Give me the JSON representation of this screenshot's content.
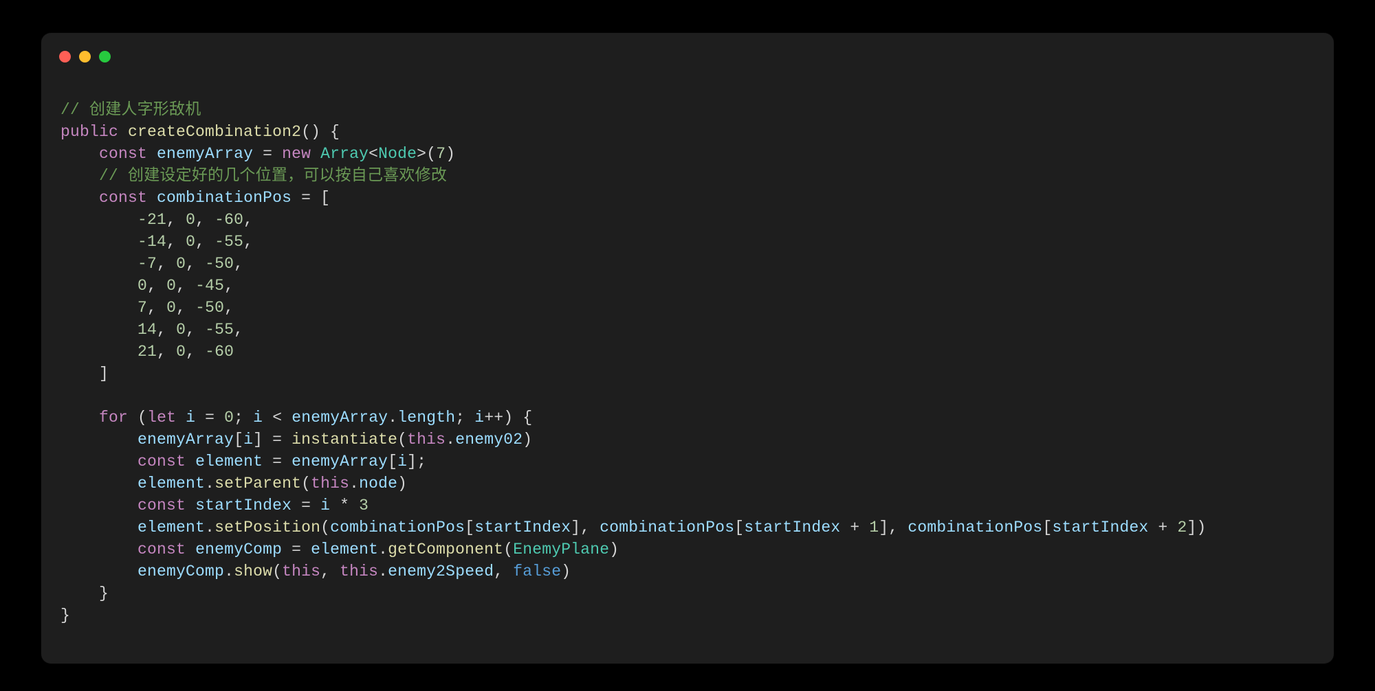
{
  "colors": {
    "window_bg": "#1e1e1e",
    "page_bg": "#000000",
    "traffic_red": "#ff5f56",
    "traffic_yellow": "#ffbd2e",
    "traffic_green": "#27c93f",
    "comment": "#6a9955",
    "keyword": "#c586c0",
    "type": "#4ec9b0",
    "function": "#dcdcaa",
    "variable": "#9cdcfe",
    "number": "#b5cea8",
    "boolean": "#569cd6",
    "default": "#d4d4d4"
  },
  "code": {
    "comment1": "// 创建人字形敌机",
    "kw_public": "public",
    "fn_createCombination2": "createCombination2",
    "paren_open": "(",
    "paren_close": ")",
    "brace_open": "{",
    "brace_close": "}",
    "kw_const": "const",
    "kw_new": "new",
    "kw_for": "for",
    "kw_let": "let",
    "kw_this": "this",
    "var_enemyArray": "enemyArray",
    "eq": " = ",
    "type_Array": "Array",
    "lt": "<",
    "gt": ">",
    "type_Node": "Node",
    "num_7": "7",
    "comment2": "// 创建设定好的几个位置，可以按自己喜欢修改",
    "var_combinationPos": "combinationPos",
    "bracket_open": "[",
    "bracket_close": "]",
    "row1": {
      "a": "-21",
      "b": "0",
      "c": "-60"
    },
    "row2": {
      "a": "-14",
      "b": "0",
      "c": "-55"
    },
    "row3": {
      "a": "-7",
      "b": "0",
      "c": "-50"
    },
    "row4": {
      "a": "0",
      "b": "0",
      "c": "-45"
    },
    "row5": {
      "a": "7",
      "b": "0",
      "c": "-50"
    },
    "row6": {
      "a": "14",
      "b": "0",
      "c": "-55"
    },
    "row7": {
      "a": "21",
      "b": "0",
      "c": "-60"
    },
    "comma": ",",
    "var_i": "i",
    "num_0": "0",
    "semicolon": ";",
    "op_lt": " < ",
    "dot": ".",
    "prop_length": "length",
    "op_inc": "++",
    "fn_instantiate": "instantiate",
    "prop_enemy02": "enemy02",
    "var_element": "element",
    "fn_setParent": "setParent",
    "prop_node": "node",
    "var_startIndex": "startIndex",
    "op_times": " * ",
    "num_3": "3",
    "fn_setPosition": "setPosition",
    "op_plus": " + ",
    "num_1": "1",
    "num_2": "2",
    "var_enemyComp": "enemyComp",
    "fn_getComponent": "getComponent",
    "type_EnemyPlane": "EnemyPlane",
    "fn_show": "show",
    "prop_enemy2Speed": "enemy2Speed",
    "bool_false": "false",
    "sep_comma_sp": ", "
  }
}
